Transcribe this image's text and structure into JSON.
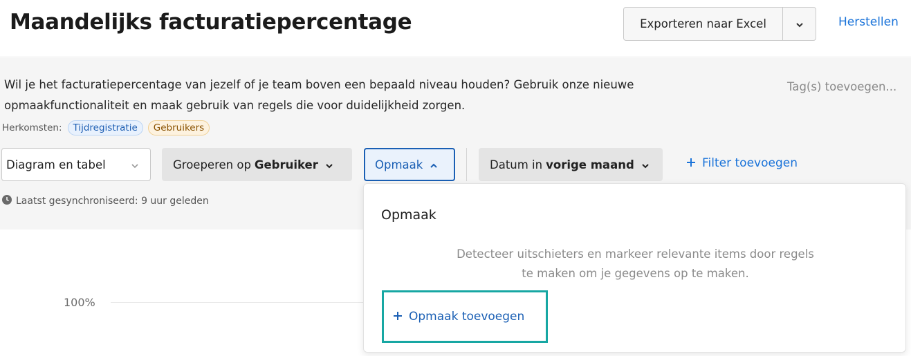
{
  "header": {
    "title": "Maandelijks facturatiepercentage",
    "export_label": "Exporteren naar Excel",
    "reset_label": "Herstellen"
  },
  "report": {
    "description": "Wil je het facturatiepercentage van jezelf of je team boven een bepaald niveau houden? Gebruik onze nieuwe opmaakfunctionaliteit en maak gebruik van regels die voor duidelijkheid zorgen.",
    "tag_add_placeholder": "Tag(s) toevoegen...",
    "origins_label": "Herkomsten:",
    "origins": [
      "Tijdregistratie",
      "Gebruikers"
    ]
  },
  "toolbar": {
    "view_select": "Diagram en tabel",
    "group_prefix": "Groeperen op",
    "group_value": "Gebruiker",
    "format_label": "Opmaak",
    "date_prefix": "Datum in",
    "date_value": "vorige maand",
    "filter_add": "Filter toevoegen"
  },
  "sync_status": "Laatst gesynchroniseerd: 9 uur geleden",
  "chart": {
    "y_tick": "100%"
  },
  "format_popover": {
    "title": "Opmaak",
    "body": "Detecteer uitschieters en markeer relevante items door regels te maken om je gegevens op te maken.",
    "add_label": "Opmaak toevoegen"
  },
  "colors": {
    "accent_blue": "#1a73d9",
    "focus_teal": "#17a7a3",
    "chip_blue": "#1f5fb3",
    "chip_orange": "#8a5200"
  }
}
